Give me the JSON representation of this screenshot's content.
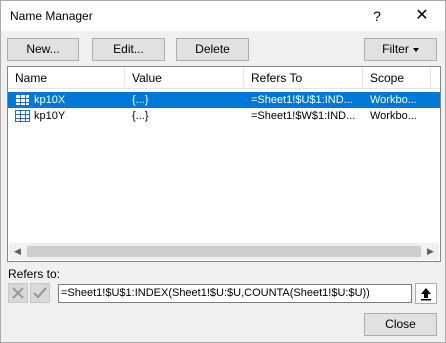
{
  "window": {
    "title": "Name Manager",
    "help_glyph": "?",
    "close_glyph": "✕"
  },
  "toolbar": {
    "new_label": "New...",
    "edit_label": "Edit...",
    "delete_label": "Delete",
    "filter_label": "Filter"
  },
  "columns": [
    "Name",
    "Value",
    "Refers To",
    "Scope"
  ],
  "rows": [
    {
      "name": "kp10X",
      "value": "{...}",
      "refers_to": "=Sheet1!$U$1:IND...",
      "scope": "Workbo...",
      "selected": true
    },
    {
      "name": "kp10Y",
      "value": "{...}",
      "refers_to": "=Sheet1!$W$1:IND...",
      "scope": "Workbo...",
      "selected": false
    }
  ],
  "refers_to": {
    "label": "Refers to:",
    "value": "=Sheet1!$U$1:INDEX(Sheet1!$U:$U,COUNTA(Sheet1!$U:$U))"
  },
  "footer": {
    "close_label": "Close"
  },
  "colors": {
    "selection": "#0078d7",
    "icon_blue": "#2b6cb8"
  }
}
